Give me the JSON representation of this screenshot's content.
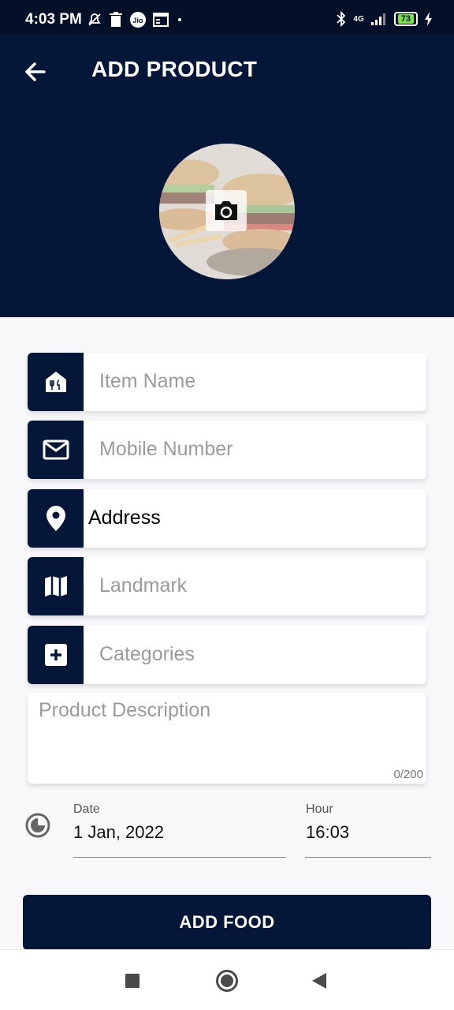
{
  "status_bar": {
    "time": "4:03 PM",
    "network": "4G",
    "battery_level": "73",
    "left_icons": [
      "mute-notification-icon",
      "trash-icon",
      "jio-icon",
      "calendar-icon",
      "dot-icon"
    ],
    "right_icons": [
      "bluetooth-icon",
      "signal-icon",
      "battery-icon",
      "charging-icon"
    ]
  },
  "header": {
    "title": "ADD PRODUCT",
    "back_icon": "arrow-left-icon",
    "photo_icon": "camera-icon"
  },
  "form": {
    "item_name": {
      "placeholder": "Item Name",
      "value": "",
      "icon": "restaurant-house-icon"
    },
    "mobile_number": {
      "placeholder": "Mobile Number",
      "value": "",
      "icon": "mail-icon"
    },
    "address": {
      "placeholder": "",
      "value": "Address",
      "icon": "location-pin-icon"
    },
    "landmark": {
      "placeholder": "Landmark",
      "value": "",
      "icon": "map-icon"
    },
    "categories": {
      "placeholder": "Categories",
      "value": "",
      "icon": "add-box-icon"
    },
    "description": {
      "placeholder": "Product Description",
      "counter": "0/200"
    }
  },
  "schedule": {
    "icon": "clock-icon",
    "date_label": "Date",
    "date_value": "1 Jan, 2022",
    "hour_label": "Hour",
    "hour_value": "16:03"
  },
  "actions": {
    "submit_label": "ADD FOOD"
  },
  "colors": {
    "primary": "#051739",
    "status_bar": "#031027",
    "placeholder": "#9b9b9b",
    "background": "#f8f8fa"
  }
}
